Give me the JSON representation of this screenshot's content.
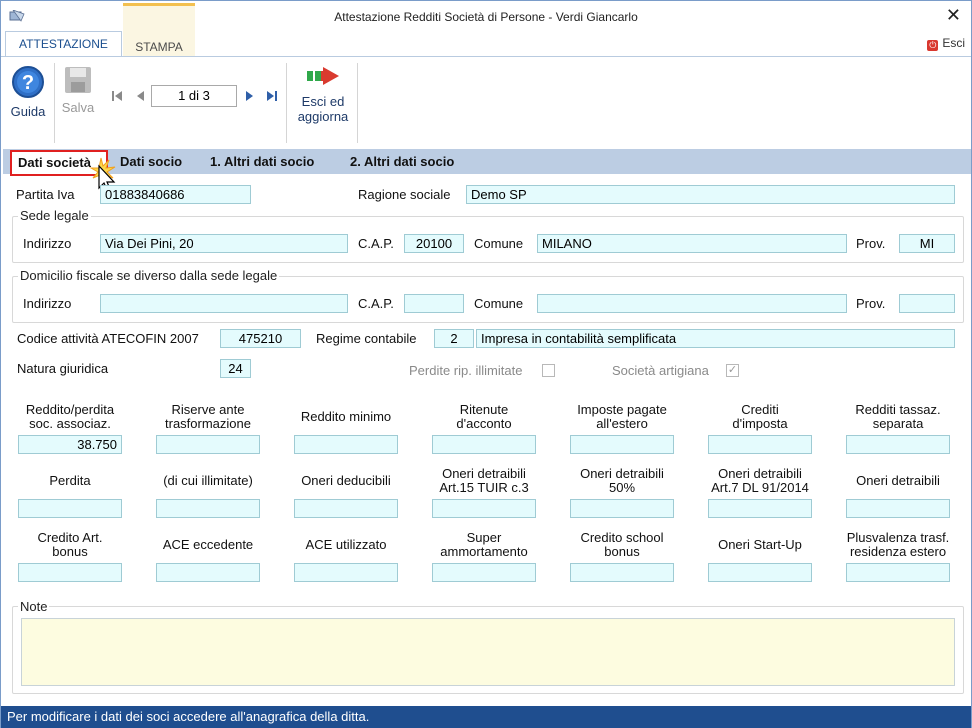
{
  "window": {
    "title": "Attestazione Redditi Società di Persone - Verdi Giancarlo",
    "close_glyph": "✕"
  },
  "ribbon": {
    "tabs": [
      {
        "label": "ATTESTAZIONE",
        "active": true
      },
      {
        "label": "STAMPA",
        "active": false
      }
    ],
    "esci_label": "Esci"
  },
  "toolbar": {
    "guida_label": "Guida",
    "salva_label": "Salva",
    "esci_label_line1": "Esci ed",
    "esci_label_line2": "aggiorna",
    "page_indicator": "1 di 3"
  },
  "subtabs": [
    {
      "label": "Dati società",
      "active": true
    },
    {
      "label": "Dati socio"
    },
    {
      "label": "1. Altri dati socio"
    },
    {
      "label": "2. Altri dati socio"
    }
  ],
  "form": {
    "partita_iva_label": "Partita Iva",
    "partita_iva": "01883840686",
    "ragione_sociale_label": "Ragione sociale",
    "ragione_sociale": "Demo SP",
    "sede_legale": {
      "title": "Sede legale",
      "indirizzo_label": "Indirizzo",
      "indirizzo": "Via Dei Pini, 20",
      "cap_label": "C.A.P.",
      "cap": "20100",
      "comune_label": "Comune",
      "comune": "MILANO",
      "prov_label": "Prov.",
      "prov": "MI"
    },
    "domicilio": {
      "title": "Domicilio fiscale se diverso dalla sede legale",
      "indirizzo_label": "Indirizzo",
      "indirizzo": "",
      "cap_label": "C.A.P.",
      "cap": "",
      "comune_label": "Comune",
      "comune": "",
      "prov_label": "Prov.",
      "prov": ""
    },
    "codice_attivita_label": "Codice attività ATECOFIN 2007",
    "codice_attivita": "475210",
    "regime_contabile_label": "Regime contabile",
    "regime_code": "2",
    "regime_desc": "Impresa  in contabilità semplificata",
    "natura_giuridica_label": "Natura giuridica",
    "natura_giuridica": "24",
    "perdite_label": "Perdite rip. illimitate",
    "perdite_checked": false,
    "artigiana_label": "Società artigiana",
    "artigiana_checked": true,
    "check_glyph": "✓"
  },
  "grid": {
    "row1": [
      {
        "l1": "Reddito/perdita",
        "l2": "soc. associaz.",
        "value": "38.750"
      },
      {
        "l1": "Riserve ante",
        "l2": "trasformazione",
        "value": ""
      },
      {
        "l1": "Reddito minimo",
        "l2": "",
        "value": ""
      },
      {
        "l1": "Ritenute",
        "l2": "d'acconto",
        "value": ""
      },
      {
        "l1": "Imposte pagate",
        "l2": "all'estero",
        "value": ""
      },
      {
        "l1": "Crediti",
        "l2": "d'imposta",
        "value": ""
      },
      {
        "l1": "Redditi tassaz.",
        "l2": "separata",
        "value": ""
      }
    ],
    "row2": [
      {
        "l1": "Perdita",
        "l2": "",
        "value": ""
      },
      {
        "l1": "(di cui illimitate)",
        "l2": "",
        "value": ""
      },
      {
        "l1": "Oneri deducibili",
        "l2": "",
        "value": ""
      },
      {
        "l1": "Oneri detraibili",
        "l2": "Art.15 TUIR c.3",
        "value": ""
      },
      {
        "l1": "Oneri detraibili",
        "l2": "50%",
        "value": ""
      },
      {
        "l1": "Oneri detraibili",
        "l2": "Art.7 DL 91/2014",
        "value": ""
      },
      {
        "l1": "Oneri detraibili",
        "l2": "",
        "value": ""
      }
    ],
    "row3": [
      {
        "l1": "Credito Art.",
        "l2": "bonus",
        "value": ""
      },
      {
        "l1": "ACE eccedente",
        "l2": "",
        "value": ""
      },
      {
        "l1": "ACE utilizzato",
        "l2": "",
        "value": ""
      },
      {
        "l1": "Super",
        "l2": "ammortamento",
        "value": ""
      },
      {
        "l1": "Credito school",
        "l2": "bonus",
        "value": ""
      },
      {
        "l1": "Oneri Start-Up",
        "l2": "",
        "value": ""
      },
      {
        "l1": "Plusvalenza trasf.",
        "l2": "residenza estero",
        "value": ""
      }
    ]
  },
  "note": {
    "label": "Note",
    "value": ""
  },
  "status": {
    "message": "Per modificare i dati dei soci accedere all'anagrafica della ditta."
  }
}
